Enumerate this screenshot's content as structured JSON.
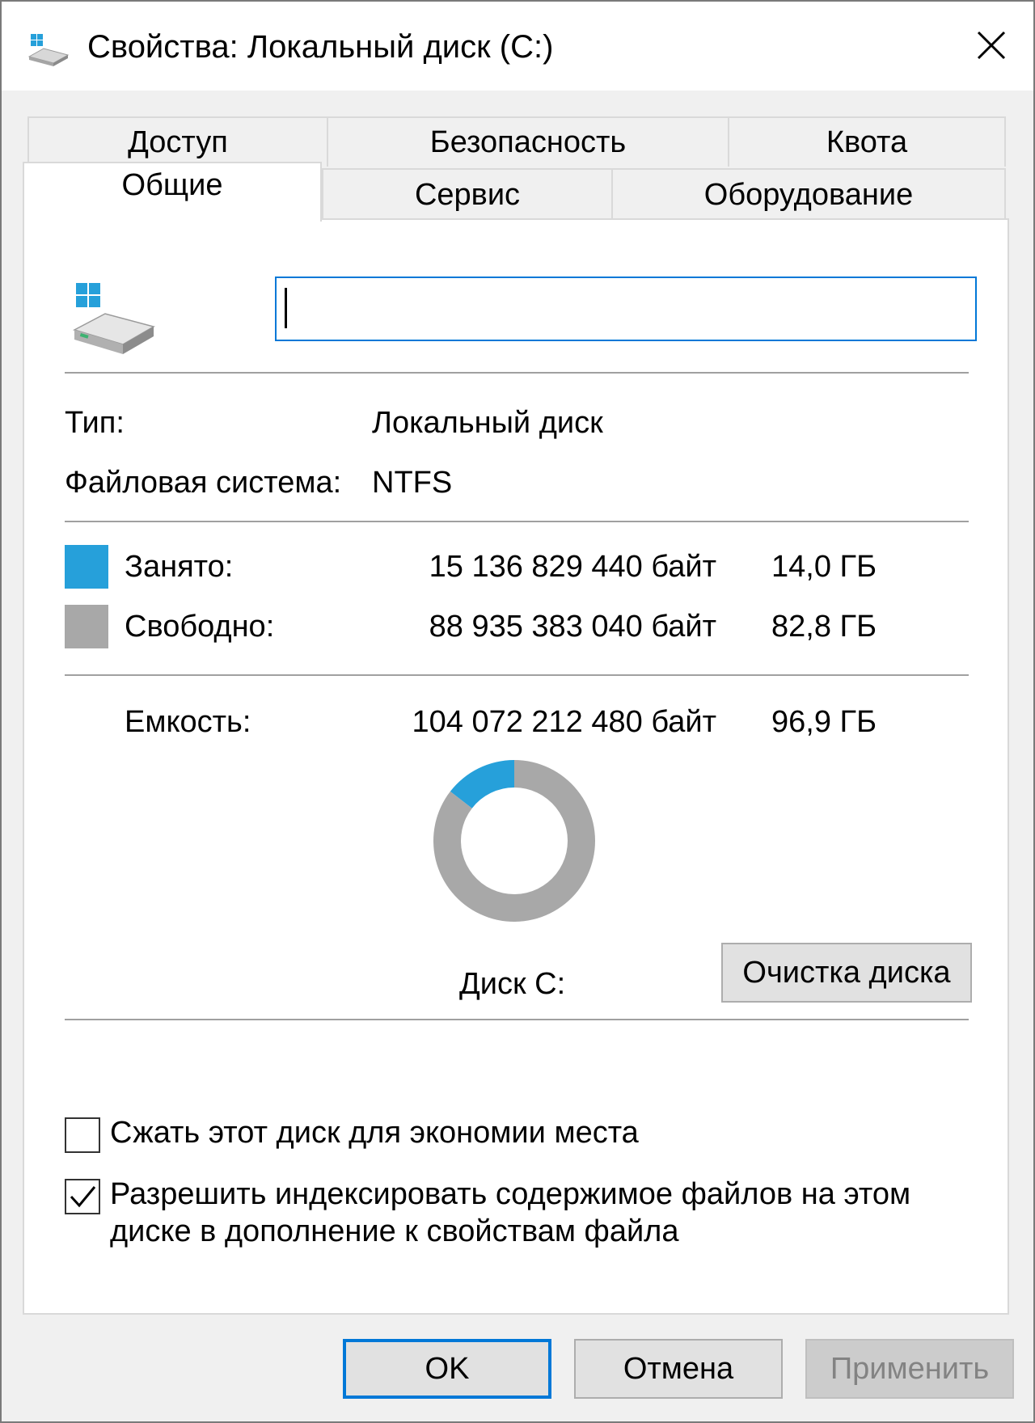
{
  "window": {
    "title": "Свойства: Локальный диск (C:)",
    "close_glyph": "✕"
  },
  "tabs": {
    "row_back": [
      "Доступ",
      "Безопасность",
      "Квота"
    ],
    "row_front": [
      "Общие",
      "Сервис",
      "Оборудование"
    ],
    "active": "Общие"
  },
  "general": {
    "volume_label_value": "",
    "type_label": "Тип:",
    "type_value": "Локальный диск",
    "fs_label": "Файловая система:",
    "fs_value": "NTFS",
    "used": {
      "label": "Занято:",
      "bytes": "15 136 829 440 байт",
      "size": "14,0 ГБ",
      "color": "#26a0da"
    },
    "free": {
      "label": "Свободно:",
      "bytes": "88 935 383 040 байт",
      "size": "82,8 ГБ",
      "color": "#a8a8a8"
    },
    "capacity": {
      "label": "Емкость:",
      "bytes": "104 072 212 480 байт",
      "size": "96,9 ГБ"
    },
    "disk_label": "Диск C:",
    "cleanup_button": "Очистка диска",
    "compress_label": "Сжать этот диск для экономии места",
    "compress_checked": false,
    "index_label_line1": "Разрешить индексировать содержимое файлов на этом",
    "index_label_line2": "диске в дополнение к свойствам файла",
    "index_checked": true
  },
  "chart_data": {
    "type": "pie",
    "categories": [
      "Занято",
      "Свободно"
    ],
    "values": [
      15136829440,
      88935383040
    ],
    "colors": [
      "#26a0da",
      "#a8a8a8"
    ]
  },
  "footer": {
    "ok": "OK",
    "cancel": "Отмена",
    "apply": "Применить"
  },
  "icons": {
    "title": "drive-icon",
    "close": "close-icon",
    "drive": "windows-drive-icon",
    "check": "checkmark-icon"
  }
}
